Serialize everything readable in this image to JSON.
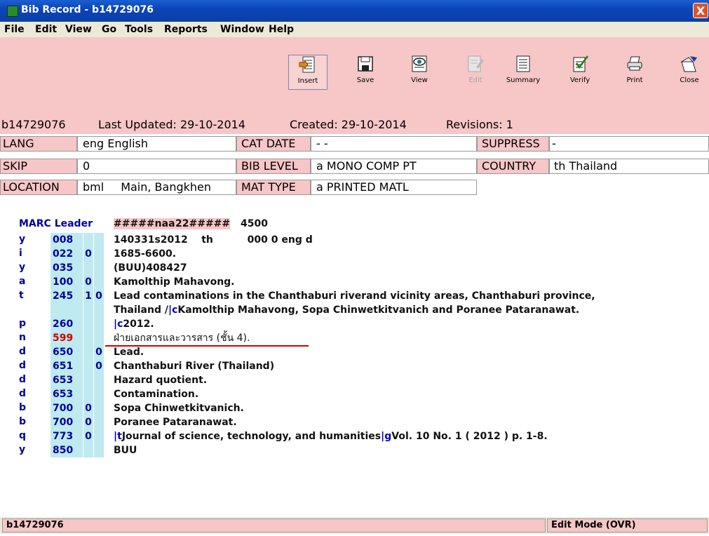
{
  "window": {
    "title": "Bib Record - b14729076",
    "close_glyph": "X"
  },
  "menu": [
    "File",
    "Edit",
    "View",
    "Go",
    "Tools",
    "Reports",
    "Window",
    "Help"
  ],
  "toolbar": [
    {
      "label": "Insert",
      "icon": "insert-icon"
    },
    {
      "label": "Save",
      "icon": "save-icon"
    },
    {
      "label": "View",
      "icon": "view-icon"
    },
    {
      "label": "Edit",
      "icon": "edit-icon"
    },
    {
      "label": "Summary",
      "icon": "summary-icon"
    },
    {
      "label": "Verify",
      "icon": "verify-icon"
    },
    {
      "label": "Print",
      "icon": "print-icon"
    },
    {
      "label": "Close",
      "icon": "close-icon"
    }
  ],
  "header": {
    "record_id": "b14729076",
    "last_updated": "Last Updated: 29-10-2014",
    "created": "Created: 29-10-2014",
    "revisions": "Revisions: 1"
  },
  "fixed_fields": {
    "lang_label": "LANG",
    "lang_value": "eng  English",
    "catdate_label": "CAT DATE",
    "catdate_value": "- -",
    "suppress_label": "SUPPRESS",
    "suppress_value": "-",
    "skip_label": "SKIP",
    "skip_value": "0",
    "biblevel_label": "BIB LEVEL",
    "biblevel_value": "a  MONO COMP PT",
    "country_label": "COUNTRY",
    "country_value": "th   Thailand",
    "location_label": "LOCATION",
    "location_code": "bml",
    "location_value": "Main, Bangkhen",
    "mattype_label": "MAT TYPE",
    "mattype_value": "a  PRINTED MATL"
  },
  "leader": {
    "label": "MARC Leader",
    "part1": "#####naa",
    "part2": "22#####",
    "part3": "4500"
  },
  "marc_fields": [
    {
      "fc": "y",
      "tag": "008",
      "i1": "",
      "i2": "",
      "data": "140331s2012    th          000 0 eng d"
    },
    {
      "fc": "i",
      "tag": "022",
      "i1": "0",
      "i2": "",
      "data": "1685-6600."
    },
    {
      "fc": "y",
      "tag": "035",
      "i1": "",
      "i2": "",
      "data": "(BUU)408427"
    },
    {
      "fc": "a",
      "tag": "100",
      "i1": "0",
      "i2": "",
      "data": "Kamolthip Mahavong."
    },
    {
      "fc": "t",
      "tag": "245",
      "i1": "1",
      "i2": "0",
      "data": "Lead contaminations in the Chanthaburi riverand vicinity areas, Chanthaburi province,",
      "data2_a": "Thailand /",
      "data2_sub": "|c",
      "data2_b": "Kamolthip Mahavong, Sopa Chinwetkitvanich and Poranee Pataranawat."
    },
    {
      "fc": "p",
      "tag": "260",
      "i1": "",
      "i2": "",
      "sub": "|c",
      "data": "2012."
    },
    {
      "fc": "n",
      "tag": "599",
      "i1": "",
      "i2": "",
      "data": "ฝ่ายเอกสารและวารสาร (ชั้น 4)."
    },
    {
      "fc": "d",
      "tag": "650",
      "i1": "",
      "i2": "0",
      "data": "Lead."
    },
    {
      "fc": "d",
      "tag": "651",
      "i1": "",
      "i2": "0",
      "data": "Chanthaburi River (Thailand)"
    },
    {
      "fc": "d",
      "tag": "653",
      "i1": "",
      "i2": "",
      "data": "Hazard quotient."
    },
    {
      "fc": "d",
      "tag": "653",
      "i1": "",
      "i2": "",
      "data": "Contamination."
    },
    {
      "fc": "b",
      "tag": "700",
      "i1": "0",
      "i2": "",
      "data": "Sopa Chinwetkitvanich."
    },
    {
      "fc": "b",
      "tag": "700",
      "i1": "0",
      "i2": "",
      "data": "Poranee Pataranawat."
    },
    {
      "fc": "q",
      "tag": "773",
      "i1": "0",
      "i2": "",
      "sub": "|t",
      "data": "Journal of science, technology, and humanities",
      "sub2": "|g",
      "data2": "Vol. 10 No. 1  ( 2012 ) p. 1-8."
    },
    {
      "fc": "y",
      "tag": "850",
      "i1": "",
      "i2": "",
      "data": "BUU"
    }
  ],
  "status": {
    "left": "b14729076",
    "right": "Edit Mode (OVR)"
  }
}
